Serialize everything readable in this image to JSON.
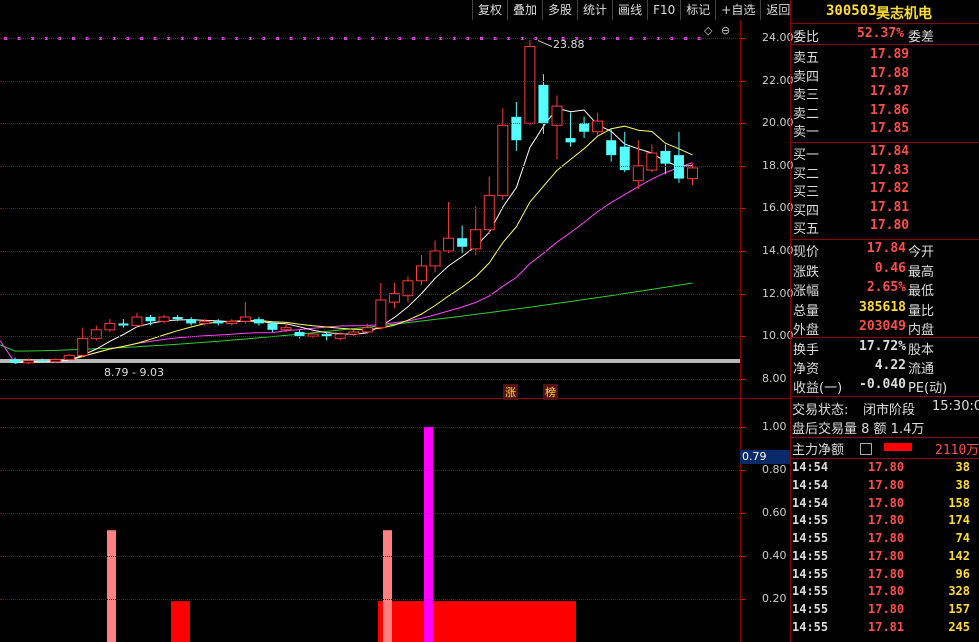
{
  "toolbar": {
    "items": [
      "复权",
      "叠加",
      "多股",
      "统计",
      "画线",
      "F10",
      "标记",
      "+自选",
      "返回"
    ]
  },
  "header": {
    "code": "300503",
    "name": "昊志机电"
  },
  "main_chart": {
    "yticks": [
      "24.00",
      "22.00",
      "20.00",
      "18.00",
      "16.00",
      "14.00",
      "12.00",
      "10.00",
      "8.00"
    ],
    "high_label": "23.88",
    "range_label": "8.79 - 9.03",
    "badge_zhang": "涨",
    "badge_bang": "榜"
  },
  "sub_chart": {
    "yticks": [
      "1.00",
      "0.80",
      "0.60",
      "0.40",
      "0.20"
    ],
    "current_value": "0.79"
  },
  "quote": {
    "weibi_label": "委比",
    "weibi_value": "52.37%",
    "weicha_label": "委差",
    "asks": [
      {
        "label": "卖五",
        "price": "17.89"
      },
      {
        "label": "卖四",
        "price": "17.88"
      },
      {
        "label": "卖三",
        "price": "17.87"
      },
      {
        "label": "卖二",
        "price": "17.86"
      },
      {
        "label": "卖一",
        "price": "17.85"
      }
    ],
    "bids": [
      {
        "label": "买一",
        "price": "17.84"
      },
      {
        "label": "买二",
        "price": "17.83"
      },
      {
        "label": "买三",
        "price": "17.82"
      },
      {
        "label": "买四",
        "price": "17.81"
      },
      {
        "label": "买五",
        "price": "17.80"
      }
    ],
    "stats": [
      {
        "label": "现价",
        "value": "17.84",
        "label2": "今开"
      },
      {
        "label": "涨跌",
        "value": "0.46",
        "label2": "最高"
      },
      {
        "label": "涨幅",
        "value": "2.65%",
        "label2": "最低"
      },
      {
        "label": "总量",
        "value": "385618",
        "label2": "量比"
      },
      {
        "label": "外盘",
        "value": "203049",
        "label2": "内盘"
      }
    ],
    "fund": [
      {
        "label": "换手",
        "value": "17.72%",
        "label2": "股本"
      },
      {
        "label": "净资",
        "value": "4.22",
        "label2": "流通"
      },
      {
        "label": "收益(一)",
        "value": "-0.040",
        "label2": "PE(动)"
      }
    ],
    "trade_status_label": "交易状态:",
    "trade_status_value": "闭市阶段",
    "trade_status_time": "15:30:0",
    "after_hours": "盘后交易量 8 额 1.4万",
    "main_net_label": "主力净额",
    "main_net_value": "2110万",
    "ticks": [
      {
        "time": "14:54",
        "price": "17.80",
        "vol": "38"
      },
      {
        "time": "14:54",
        "price": "17.80",
        "vol": "38"
      },
      {
        "time": "14:54",
        "price": "17.80",
        "vol": "158"
      },
      {
        "time": "14:55",
        "price": "17.80",
        "vol": "174"
      },
      {
        "time": "14:55",
        "price": "17.80",
        "vol": "74"
      },
      {
        "time": "14:55",
        "price": "17.80",
        "vol": "142"
      },
      {
        "time": "14:55",
        "price": "17.80",
        "vol": "96"
      },
      {
        "time": "14:55",
        "price": "17.80",
        "vol": "328"
      },
      {
        "time": "14:55",
        "price": "17.80",
        "vol": "157"
      },
      {
        "time": "14:55",
        "price": "17.81",
        "vol": "245"
      }
    ]
  },
  "colors": {
    "up": "#ff3b3b",
    "down": "#54ffff",
    "ma5": "#ffffff",
    "ma10": "#ffff66",
    "ma20": "#ff44ff",
    "ma60": "#33cc33",
    "price_red": "#ff4d4d",
    "yellow": "#ffdd33"
  },
  "candles": [
    [
      8.9,
      8.75,
      9.0,
      8.7
    ],
    [
      8.75,
      8.85,
      8.95,
      8.7
    ],
    [
      8.85,
      8.8,
      8.95,
      8.75
    ],
    [
      8.8,
      8.9,
      8.95,
      8.75
    ],
    [
      8.9,
      9.1,
      9.15,
      8.85
    ],
    [
      9.1,
      9.9,
      10.4,
      9.0
    ],
    [
      9.9,
      10.3,
      10.5,
      9.8
    ],
    [
      10.3,
      10.6,
      10.8,
      10.2
    ],
    [
      10.6,
      10.5,
      10.8,
      10.4
    ],
    [
      10.5,
      10.9,
      11.1,
      10.4
    ],
    [
      10.9,
      10.7,
      11.0,
      10.5
    ],
    [
      10.7,
      10.9,
      11.0,
      10.6
    ],
    [
      10.9,
      10.8,
      11.0,
      10.7
    ],
    [
      10.8,
      10.6,
      10.9,
      10.5
    ],
    [
      10.6,
      10.7,
      10.8,
      10.5
    ],
    [
      10.7,
      10.6,
      10.8,
      10.5
    ],
    [
      10.6,
      10.7,
      10.8,
      10.5
    ],
    [
      10.7,
      10.9,
      11.6,
      10.6
    ],
    [
      10.8,
      10.6,
      10.9,
      10.5
    ],
    [
      10.6,
      10.3,
      10.7,
      10.2
    ],
    [
      10.3,
      10.4,
      10.6,
      10.2
    ],
    [
      10.2,
      10.0,
      10.3,
      9.9
    ],
    [
      10.0,
      10.1,
      10.2,
      9.9
    ],
    [
      10.1,
      10.0,
      10.2,
      9.8
    ],
    [
      9.9,
      10.1,
      10.2,
      9.8
    ],
    [
      10.1,
      10.2,
      10.3,
      10.0
    ],
    [
      10.2,
      10.4,
      10.6,
      10.1
    ],
    [
      10.4,
      11.7,
      12.5,
      10.3
    ],
    [
      11.6,
      12.0,
      12.5,
      11.3
    ],
    [
      11.9,
      12.6,
      12.8,
      11.6
    ],
    [
      12.6,
      13.3,
      13.8,
      12.4
    ],
    [
      13.3,
      14.0,
      14.5,
      13.0
    ],
    [
      14.0,
      14.6,
      16.3,
      13.9
    ],
    [
      14.6,
      14.2,
      15.2,
      13.9
    ],
    [
      14.1,
      15.0,
      16.1,
      13.8
    ],
    [
      15.0,
      16.6,
      17.5,
      14.8
    ],
    [
      16.6,
      19.9,
      20.7,
      16.4
    ],
    [
      20.3,
      19.2,
      21.0,
      18.7
    ],
    [
      20.0,
      23.6,
      23.9,
      19.9
    ],
    [
      21.8,
      20.0,
      22.3,
      19.5
    ],
    [
      19.9,
      20.8,
      21.3,
      18.3
    ],
    [
      19.3,
      19.1,
      20.5,
      18.9
    ],
    [
      20.0,
      19.6,
      20.3,
      19.3
    ],
    [
      19.6,
      20.1,
      20.5,
      19.4
    ],
    [
      19.2,
      18.5,
      19.7,
      18.2
    ],
    [
      18.9,
      17.8,
      19.6,
      17.7
    ],
    [
      17.3,
      18.0,
      19.2,
      16.9
    ],
    [
      17.8,
      18.6,
      19.0,
      17.7
    ],
    [
      18.7,
      18.1,
      19.0,
      17.6
    ],
    [
      18.5,
      17.4,
      19.6,
      17.2
    ],
    [
      17.4,
      17.9,
      18.1,
      17.1
    ]
  ],
  "subbars": {
    "pink": [
      [
        5,
        0.52
      ],
      [
        26,
        0.52
      ]
    ],
    "red_small": [
      [
        8.8,
        0.19
      ]
    ],
    "magenta": [
      [
        29.5,
        1.0
      ]
    ],
    "red_block": [
      [
        26,
        0.19
      ]
    ]
  }
}
